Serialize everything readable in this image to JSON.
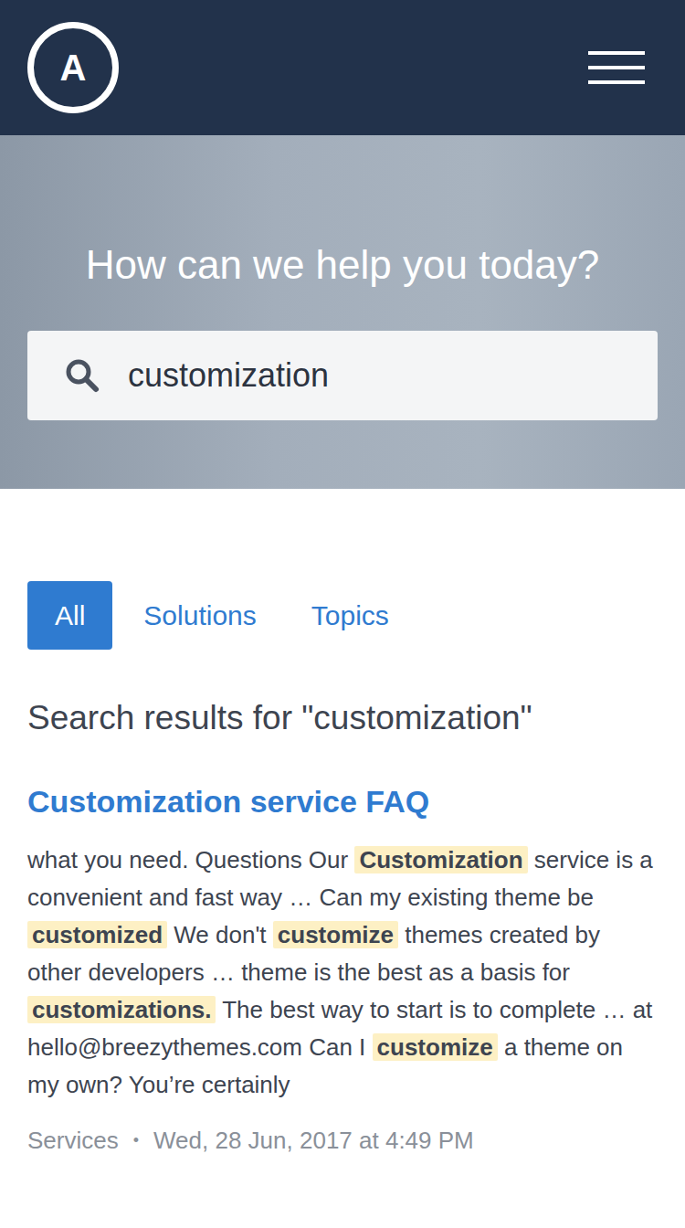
{
  "header": {
    "logo": "A"
  },
  "hero": {
    "title": "How can we help you today?"
  },
  "search": {
    "value": "customization"
  },
  "tabs": [
    {
      "label": "All",
      "selected": true
    },
    {
      "label": "Solutions",
      "selected": false
    },
    {
      "label": "Topics",
      "selected": false
    }
  ],
  "results_heading": "Search results for \"customization\"",
  "results": [
    {
      "title": "Customization service FAQ",
      "snippet": [
        {
          "text": "what you need.  Questions Our ",
          "highlighted": false
        },
        {
          "text": "Customization",
          "highlighted": true
        },
        {
          "text": " service is a convenient and fast way … Can my existing theme be ",
          "highlighted": false
        },
        {
          "text": "customized",
          "highlighted": true
        },
        {
          "text": " We don't ",
          "highlighted": false
        },
        {
          "text": "customize",
          "highlighted": true
        },
        {
          "text": " themes created by other developers … theme is the best as a basis for ",
          "highlighted": false
        },
        {
          "text": "customizations.",
          "highlighted": true
        },
        {
          "text": " The best way to start is to complete … at hello@breezythemes.com Can I ",
          "highlighted": false
        },
        {
          "text": "customize",
          "highlighted": true
        },
        {
          "text": " a theme on my own? You’re certainly",
          "highlighted": false
        }
      ],
      "category": "Services",
      "separator": "•",
      "date": "Wed, 28 Jun, 2017 at 4:49 PM"
    }
  ]
}
